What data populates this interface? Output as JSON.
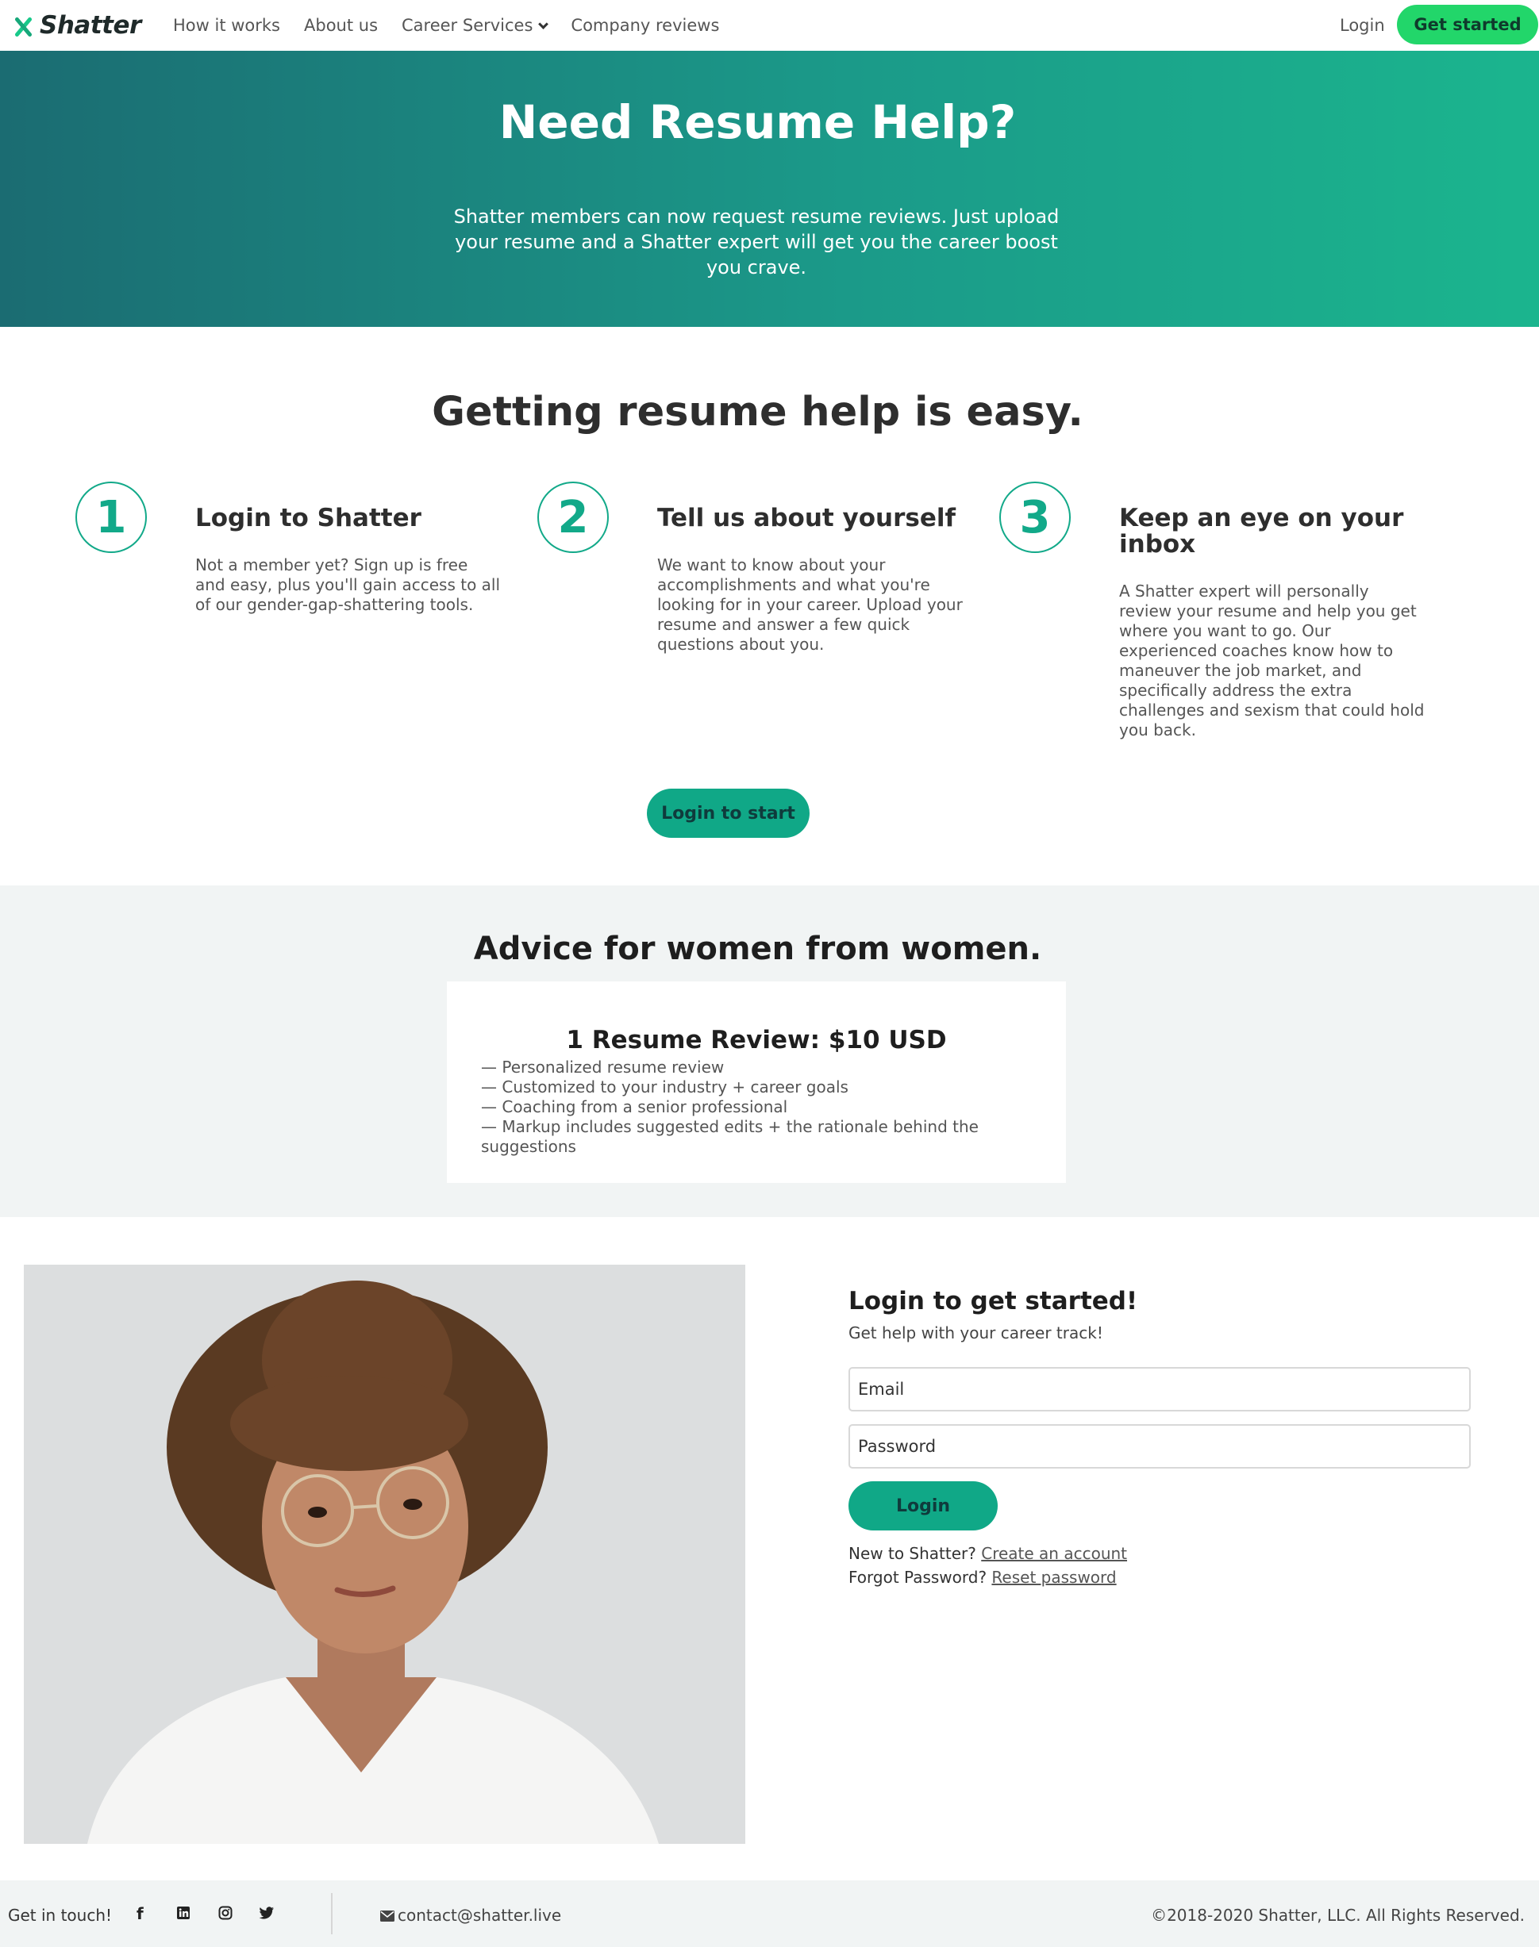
{
  "nav": {
    "brand": "Shatter",
    "links": [
      "How it works",
      "About us",
      "Career Services",
      "Company reviews"
    ],
    "login": "Login",
    "cta": "Get started"
  },
  "hero": {
    "title": "Need Resume Help?",
    "subtitle": "Shatter members can now request resume reviews. Just upload your resume and a Shatter expert will get you the career boost you crave."
  },
  "steps": {
    "title": "Getting resume help is easy.",
    "items": [
      {
        "num": "1",
        "title": "Login to Shatter",
        "body": "Not a member yet? Sign up is free and easy, plus you'll gain access to all of our gender-gap-shattering tools."
      },
      {
        "num": "2",
        "title": "Tell us about yourself",
        "body": "We want to know about your accomplishments and what you're looking for in your career. Upload your resume and answer a few quick questions about you."
      },
      {
        "num": "3",
        "title": "Keep an eye on your inbox",
        "body": "A Shatter expert will personally review your resume and help you get where you want to go. Our experienced coaches know how to maneuver the job market, and specifically address the extra challenges and sexism that could hold you back."
      }
    ],
    "button": "Login to start"
  },
  "advice": {
    "title": "Advice for women from women.",
    "card_title": "1 Resume Review: $10 USD",
    "features": [
      "— Personalized resume review",
      "— Customized to your industry + career goals",
      "— Coaching from a senior professional",
      "— Markup includes suggested edits + the rationale behind the suggestions"
    ]
  },
  "login": {
    "title": "Login to get started!",
    "subtitle": "Get help with your career track!",
    "email_placeholder": "Email",
    "password_placeholder": "Password",
    "button": "Login",
    "new_prompt": "New to Shatter?",
    "create_link": "Create an account",
    "forgot_prompt": "Forgot Password?",
    "reset_link": "Reset password"
  },
  "footer": {
    "touch": "Get in touch!",
    "social_icons": [
      "facebook-icon",
      "linkedin-icon",
      "instagram-icon",
      "twitter-icon"
    ],
    "email": "contact@shatter.live",
    "copyright": "©2018-2020 Shatter, LLC. All Rights Reserved."
  },
  "colors": {
    "accent": "#10a887",
    "cta_green": "#22d66a",
    "hero_start": "#1b6c72",
    "hero_end": "#1bb58e"
  }
}
